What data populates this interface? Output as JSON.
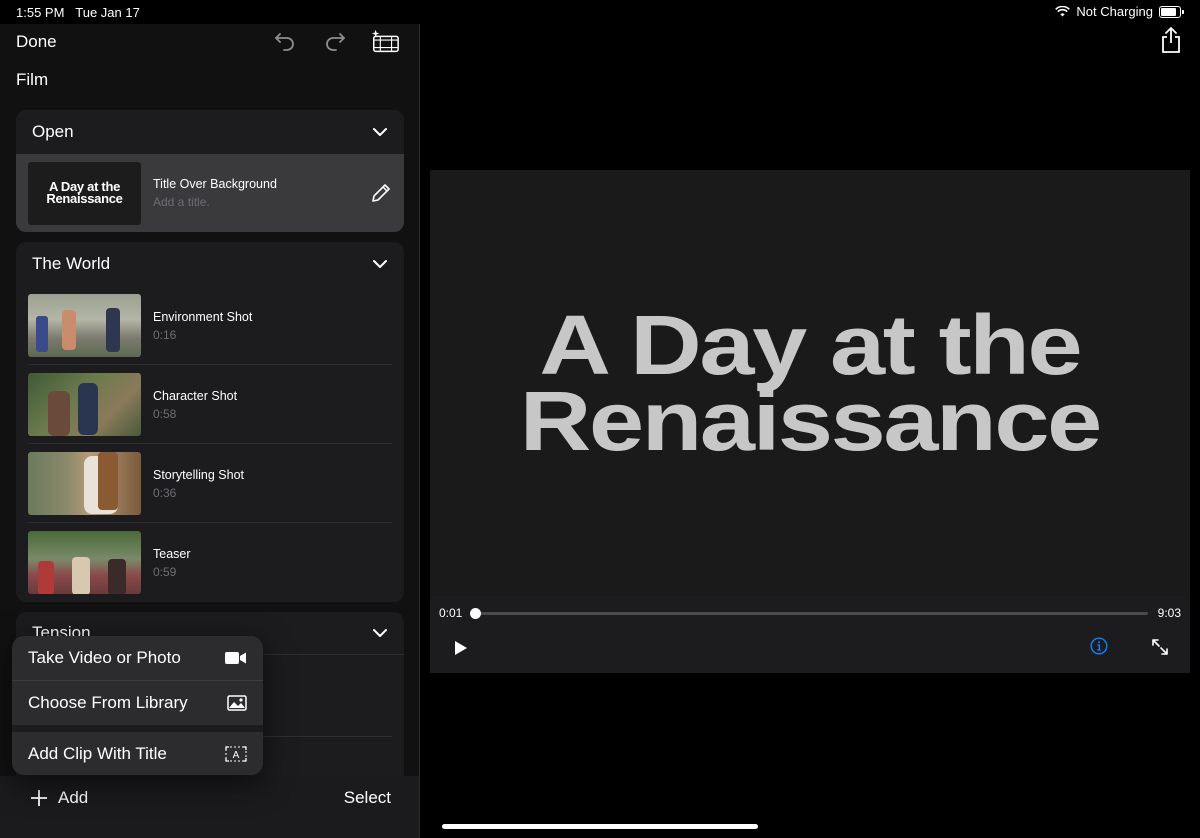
{
  "status": {
    "time": "1:55 PM",
    "date": "Tue Jan 17",
    "charging": "Not Charging"
  },
  "toolbar": {
    "done_label": "Done"
  },
  "project": {
    "type_label": "Film"
  },
  "sections": [
    {
      "name": "Open",
      "clips": [
        {
          "title": "Title Over Background",
          "subtitle": "Add a title.",
          "thumb_text_1": "A Day at the",
          "thumb_text_2": "Renaissance"
        }
      ]
    },
    {
      "name": "The World",
      "clips": [
        {
          "title": "Environment Shot",
          "duration": "0:16"
        },
        {
          "title": "Character Shot",
          "duration": "0:58"
        },
        {
          "title": "Storytelling Shot",
          "duration": "0:36"
        },
        {
          "title": "Teaser",
          "duration": "0:59"
        }
      ]
    },
    {
      "name": "Tension",
      "clips": []
    }
  ],
  "add_menu": {
    "items": [
      {
        "label": "Take Video or Photo",
        "icon": "video-camera-icon"
      },
      {
        "label": "Choose From Library",
        "icon": "photo-icon"
      },
      {
        "label": "Add Clip With Title",
        "icon": "title-card-icon"
      }
    ]
  },
  "bottom_bar": {
    "add_label": "Add",
    "select_label": "Select"
  },
  "player": {
    "title_line_1": "A Day at the",
    "title_line_2": "Renaissance",
    "current_time": "0:01",
    "total_time": "9:03",
    "progress": 0.002
  },
  "colors": {
    "accent": "#0a84ff",
    "card": "#1c1c1e",
    "selected_row": "#3a3a3c"
  }
}
